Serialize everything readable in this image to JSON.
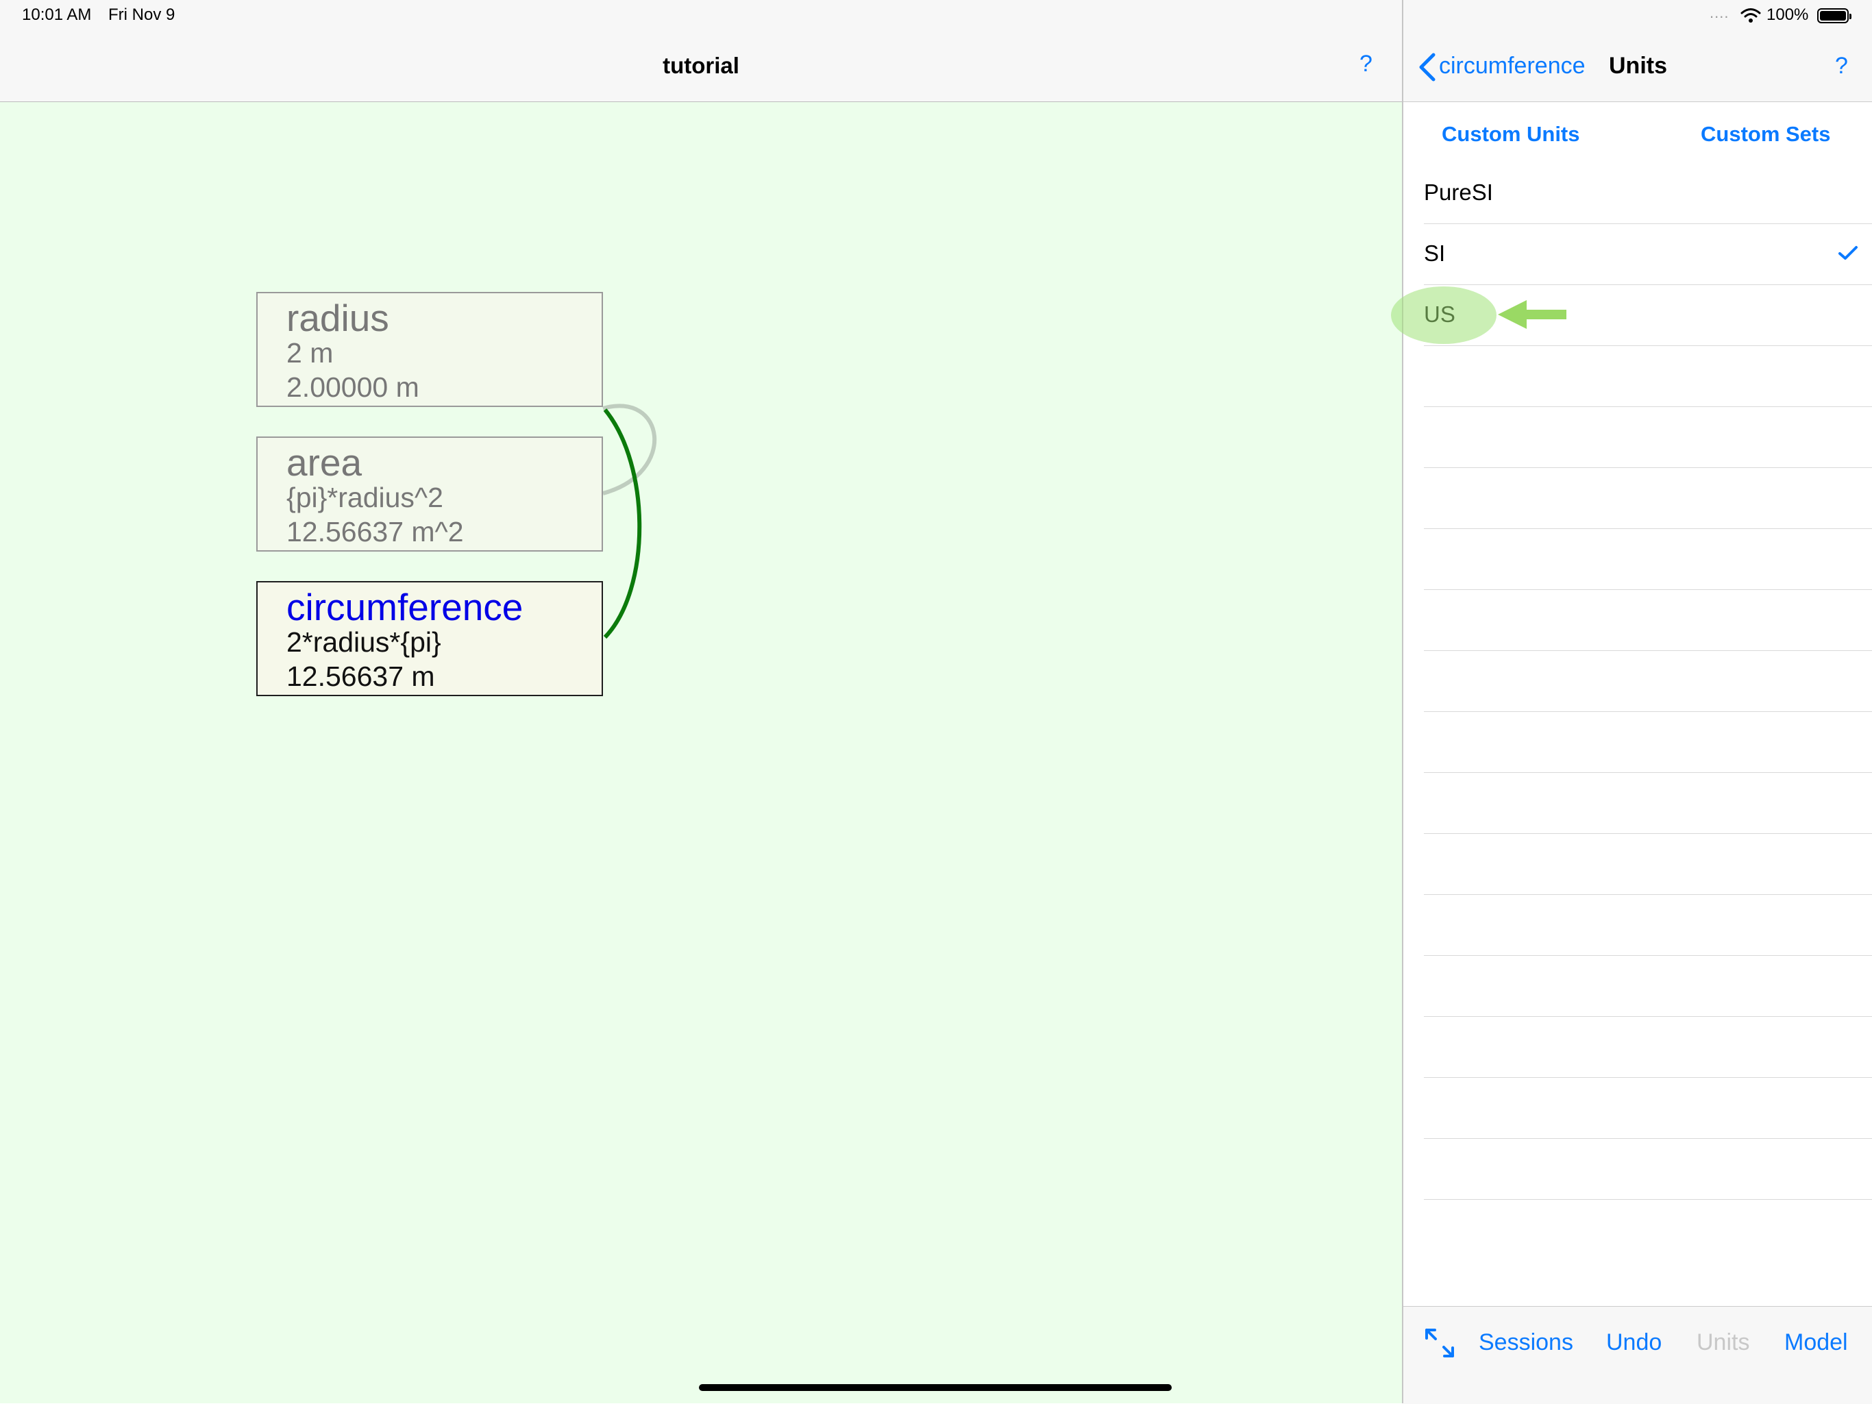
{
  "status_bar": {
    "time": "10:01 AM",
    "date": "Fri Nov 9",
    "signal": "....",
    "battery_percent": "100%"
  },
  "left_pane": {
    "title": "tutorial",
    "help": "?",
    "nodes": [
      {
        "title": "radius",
        "expression": "2 m",
        "value": "2.00000 m",
        "selected": false
      },
      {
        "title": "area",
        "expression": "{pi}*radius^2",
        "value": "12.56637 m^2",
        "selected": false
      },
      {
        "title": "circumference",
        "expression": "2*radius*{pi}",
        "value": "12.56637 m",
        "selected": true
      }
    ]
  },
  "right_pane": {
    "back_label": "circumference",
    "title": "Units",
    "help": "?",
    "segments": [
      "Custom Units",
      "Custom Sets"
    ],
    "unit_sets": [
      {
        "label": "PureSI",
        "checked": false
      },
      {
        "label": "SI",
        "checked": true
      },
      {
        "label": "US",
        "checked": false,
        "highlighted": true
      },
      {
        "label": ""
      },
      {
        "label": ""
      },
      {
        "label": ""
      },
      {
        "label": ""
      },
      {
        "label": ""
      },
      {
        "label": ""
      },
      {
        "label": ""
      },
      {
        "label": ""
      },
      {
        "label": ""
      },
      {
        "label": ""
      },
      {
        "label": ""
      },
      {
        "label": ""
      },
      {
        "label": ""
      },
      {
        "label": ""
      }
    ],
    "toolbar": {
      "expand_icon": "expand-arrows-icon",
      "items": [
        {
          "label": "Sessions",
          "enabled": true
        },
        {
          "label": "Undo",
          "enabled": true
        },
        {
          "label": "Units",
          "enabled": false
        },
        {
          "label": "Model",
          "enabled": true
        }
      ]
    }
  },
  "colors": {
    "canvas_background": "#ecfeeb",
    "accent": "#0a7aff",
    "selected_node_title": "#0000e6",
    "dependency_link": "#0b7a0b",
    "inactive_link": "#bfcdbf",
    "highlight": "#a0e278"
  }
}
